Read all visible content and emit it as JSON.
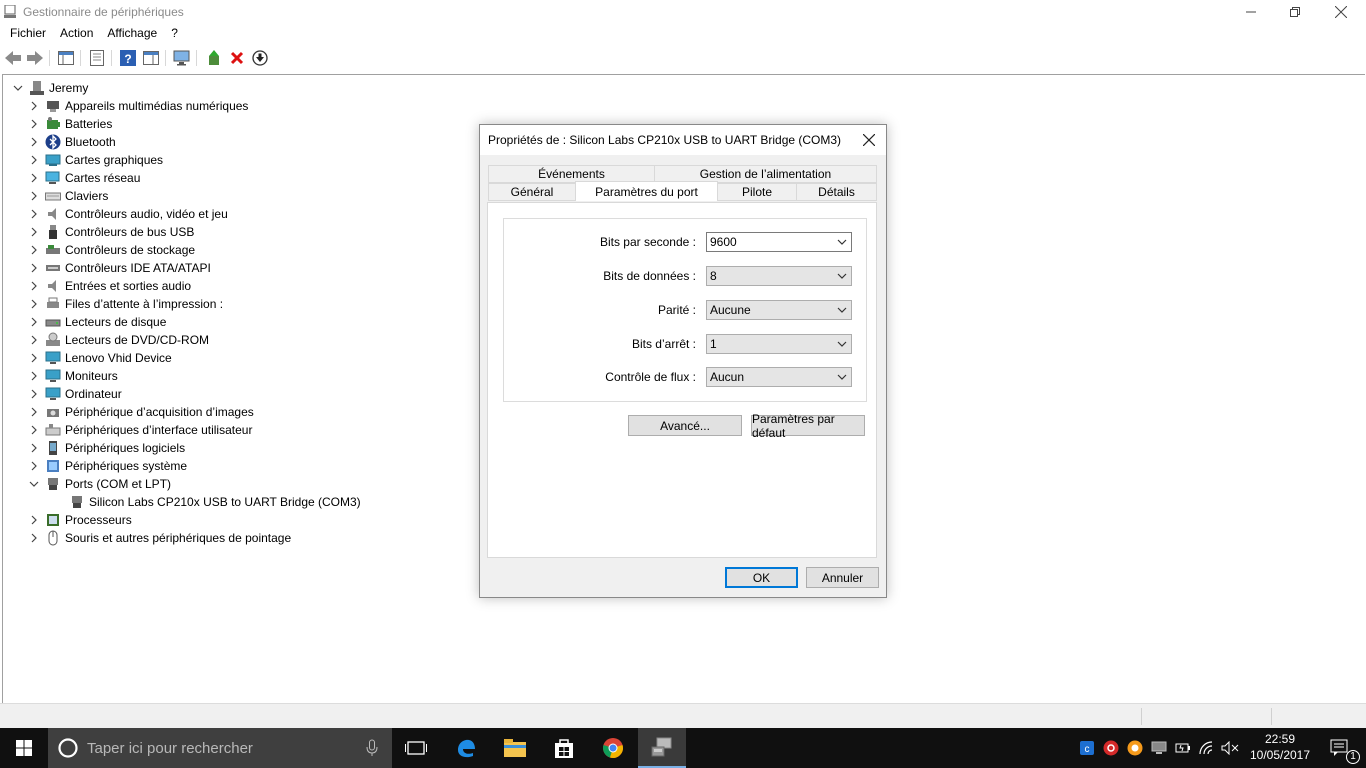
{
  "window": {
    "title": "Gestionnaire de périphériques"
  },
  "menu": [
    "Fichier",
    "Action",
    "Affichage",
    "?"
  ],
  "tree": {
    "root": "Jeremy",
    "items": [
      {
        "label": "Appareils multimédias numériques",
        "expanded": false,
        "icon": "multimedia-device-icon"
      },
      {
        "label": "Batteries",
        "expanded": false,
        "icon": "battery-icon"
      },
      {
        "label": "Bluetooth",
        "expanded": false,
        "icon": "bluetooth-icon"
      },
      {
        "label": "Cartes graphiques",
        "expanded": false,
        "icon": "display-adapter-icon"
      },
      {
        "label": "Cartes réseau",
        "expanded": false,
        "icon": "network-adapter-icon"
      },
      {
        "label": "Claviers",
        "expanded": false,
        "icon": "keyboard-icon"
      },
      {
        "label": "Contrôleurs audio, vidéo et jeu",
        "expanded": false,
        "icon": "audio-icon"
      },
      {
        "label": "Contrôleurs de bus USB",
        "expanded": false,
        "icon": "usb-icon"
      },
      {
        "label": "Contrôleurs de stockage",
        "expanded": false,
        "icon": "storage-controller-icon"
      },
      {
        "label": "Contrôleurs IDE ATA/ATAPI",
        "expanded": false,
        "icon": "ide-controller-icon"
      },
      {
        "label": "Entrées et sorties audio",
        "expanded": false,
        "icon": "audio-io-icon"
      },
      {
        "label": "Files d’attente à l’impression :",
        "expanded": false,
        "icon": "print-queue-icon"
      },
      {
        "label": "Lecteurs de disque",
        "expanded": false,
        "icon": "disk-drive-icon"
      },
      {
        "label": "Lecteurs de DVD/CD-ROM",
        "expanded": false,
        "icon": "dvd-drive-icon"
      },
      {
        "label": "Lenovo Vhid Device",
        "expanded": false,
        "icon": "monitor-icon"
      },
      {
        "label": "Moniteurs",
        "expanded": false,
        "icon": "monitor-icon"
      },
      {
        "label": "Ordinateur",
        "expanded": false,
        "icon": "computer-icon"
      },
      {
        "label": "Périphérique d’acquisition d’images",
        "expanded": false,
        "icon": "camera-icon"
      },
      {
        "label": "Périphériques d’interface utilisateur",
        "expanded": false,
        "icon": "hid-icon"
      },
      {
        "label": "Périphériques logiciels",
        "expanded": false,
        "icon": "software-device-icon"
      },
      {
        "label": "Périphériques système",
        "expanded": false,
        "icon": "system-device-icon"
      },
      {
        "label": "Ports (COM et LPT)",
        "expanded": true,
        "icon": "port-icon"
      },
      {
        "label": "Silicon Labs CP210x USB to UART Bridge (COM3)",
        "child": true,
        "icon": "port-icon"
      },
      {
        "label": "Processeurs",
        "expanded": false,
        "icon": "processor-icon"
      },
      {
        "label": "Souris et autres périphériques de pointage",
        "expanded": false,
        "icon": "mouse-icon"
      }
    ]
  },
  "dialog": {
    "title": "Propriétés de : Silicon Labs CP210x USB to UART Bridge (COM3)",
    "tabs_top": [
      "Événements",
      "Gestion de l’alimentation"
    ],
    "tabs_bottom": [
      "Général",
      "Paramètres du port",
      "Pilote",
      "Détails"
    ],
    "active_tab": "Paramètres du port",
    "fields": [
      {
        "label": "Bits par seconde :",
        "value": "9600"
      },
      {
        "label": "Bits de données :",
        "value": "8"
      },
      {
        "label": "Parité :",
        "value": "Aucune"
      },
      {
        "label": "Bits d’arrêt :",
        "value": "1"
      },
      {
        "label": "Contrôle de flux :",
        "value": "Aucun"
      }
    ],
    "advanced_label": "Avancé...",
    "defaults_label": "Paramètres par défaut",
    "ok_label": "OK",
    "cancel_label": "Annuler"
  },
  "taskbar": {
    "search_placeholder": "Taper ici pour rechercher",
    "time": "22:59",
    "date": "10/05/2017",
    "notification_count": "1"
  },
  "colors": {
    "accent": "#0078d7",
    "taskbar": "#101010",
    "search": "#3f3f3f"
  }
}
